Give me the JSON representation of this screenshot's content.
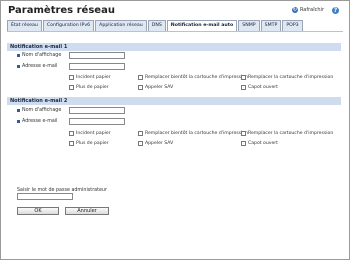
{
  "header": {
    "title": "Paramètres réseau",
    "refresh_label": "Rafraîchir",
    "refresh_icon": "refresh-icon",
    "help_icon": "help-icon",
    "help_glyph": "?"
  },
  "tabs": [
    {
      "label": "État réseau"
    },
    {
      "label": "Configuration IPv6"
    },
    {
      "label": "Application réseau"
    },
    {
      "label": "DNS"
    },
    {
      "label": "Notification e-mail auto"
    },
    {
      "label": "SNMP"
    },
    {
      "label": "SMTP"
    },
    {
      "label": "POP3"
    }
  ],
  "active_tab": "Notification e-mail auto",
  "sections": [
    {
      "title": "Notification e-mail 1",
      "display_name_label": "Nom d'affichage",
      "display_name_value": "",
      "email_label": "Adresse e-mail",
      "email_value": "",
      "options": [
        "Incident papier",
        "Remplacer bientôt la cartouche d'impression",
        "Remplacer la cartouche d'impression",
        "Plus de papier",
        "Appeler SAV",
        "Capot ouvert"
      ]
    },
    {
      "title": "Notification e-mail 2",
      "display_name_label": "Nom d'affichage",
      "display_name_value": "",
      "email_label": "Adresse e-mail",
      "email_value": "",
      "options": [
        "Incident papier",
        "Remplacer bientôt la cartouche d'impression",
        "Remplacer la cartouche d'impression",
        "Plus de papier",
        "Appeler SAV",
        "Capot ouvert"
      ]
    }
  ],
  "admin": {
    "label": "Saisir le mot de passe administrateur",
    "value": ""
  },
  "buttons": {
    "ok": "OK",
    "cancel": "Annuler"
  },
  "colors": {
    "section_header_bg": "#cfdcef",
    "tab_bg": "#dfe7f2",
    "accent": "#2f6fb8"
  }
}
